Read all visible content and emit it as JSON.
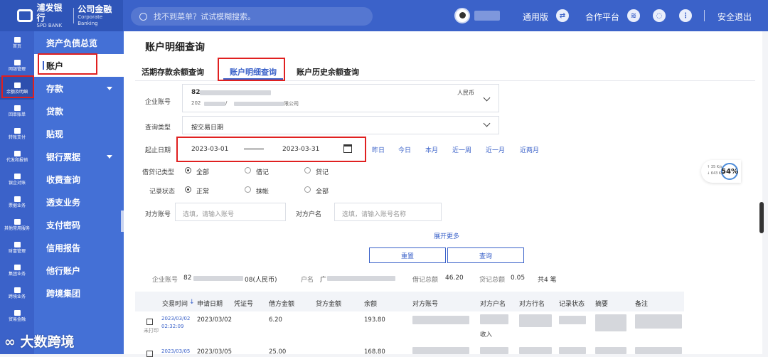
{
  "brand": {
    "name_cn": "浦发银行",
    "name_en": "SPD BANK",
    "division_cn": "公司金融",
    "division_en": "Corporate Banking"
  },
  "search": {
    "placeholder": "找不到菜单？试试模糊搜索。"
  },
  "topbar": {
    "version": "通用版",
    "partner": "合作平台",
    "logout": "安全退出"
  },
  "iconbar": [
    {
      "label": "首页",
      "icon": "home-icon"
    },
    {
      "label": "网银管理",
      "icon": "manage-icon"
    },
    {
      "label": "余额及明细",
      "icon": "balance-icon"
    },
    {
      "label": "回单账单",
      "icon": "receipt-icon"
    },
    {
      "label": "转账支付",
      "icon": "transfer-icon"
    },
    {
      "label": "代发和报销",
      "icon": "payroll-icon"
    },
    {
      "label": "银企对账",
      "icon": "reconcile-icon"
    },
    {
      "label": "票据业务",
      "icon": "bill-icon"
    },
    {
      "label": "其他常用服务",
      "icon": "grid-icon"
    },
    {
      "label": "财富管理",
      "icon": "wealth-icon"
    },
    {
      "label": "集团业务",
      "icon": "group-icon"
    },
    {
      "label": "跨境业务",
      "icon": "crossborder-icon"
    },
    {
      "label": "贸易金融",
      "icon": "trade-icon"
    }
  ],
  "menu": [
    "资产负债总览",
    "账户",
    "存款",
    "贷款",
    "贴现",
    "银行票据",
    "收费查询",
    "透支业务",
    "支付密码",
    "信用报告",
    "他行账户",
    "跨境集团"
  ],
  "page": {
    "title": "账户明细查询",
    "tabs": [
      "活期存款余额查询",
      "账户明细查询",
      "账户历史余额查询"
    ]
  },
  "form": {
    "account_label": "企业账号",
    "account_prefix": "82",
    "account_sub_prefix": "202",
    "account_sub_suffix": "限公司",
    "currency": "人民币",
    "query_type_label": "查询类型",
    "query_type": "按交易日期",
    "date_label": "起止日期",
    "date_start": "2023-03-01",
    "date_end": "2023-03-31",
    "quick_ranges": [
      "昨日",
      "今日",
      "本月",
      "近一周",
      "近一月",
      "近两月"
    ],
    "dc_label": "借贷记类型",
    "dc_options": [
      "全部",
      "借记",
      "贷记"
    ],
    "status_label": "记录状态",
    "status_options": [
      "正常",
      "抹帐",
      "全部"
    ],
    "cp_account_label": "对方账号",
    "cp_account_placeholder": "选填，请输入账号",
    "cp_name_label": "对方户名",
    "cp_name_placeholder": "选填，请输入账号名称",
    "expand": "展开更多",
    "reset": "重置",
    "query": "查询"
  },
  "summary": {
    "account_label": "企业账号",
    "account_prefix": "82",
    "account_suffix": "08(人民币)",
    "name_label": "户名",
    "name_prefix": "广",
    "debit_label": "借记总额",
    "debit_total": "46.20",
    "credit_label": "贷记总额",
    "credit_total": "0.05",
    "count": "共4 笔"
  },
  "table": {
    "headers": [
      "交易时间",
      "申请日期",
      "凭证号",
      "借方金额",
      "贷方金额",
      "余额",
      "对方账号",
      "对方户名",
      "对方行名",
      "记录状态",
      "摘要",
      "备注"
    ],
    "sort_icon": "↓",
    "rows": [
      {
        "txn_date": "2023/03/02",
        "txn_time": "02:32:09",
        "apply_date": "2023/03/02",
        "debit": "6.20",
        "balance": "193.80",
        "print_state": "未打印",
        "name_tail": "收入"
      },
      {
        "txn_date": "2023/03/05",
        "apply_date": "2023/03/05",
        "debit": "25.00",
        "balance": "168.80"
      }
    ]
  },
  "speed": {
    "percent": "54%",
    "up": "35 K/s",
    "down": "643 K/s"
  },
  "watermark": "大数跨境"
}
